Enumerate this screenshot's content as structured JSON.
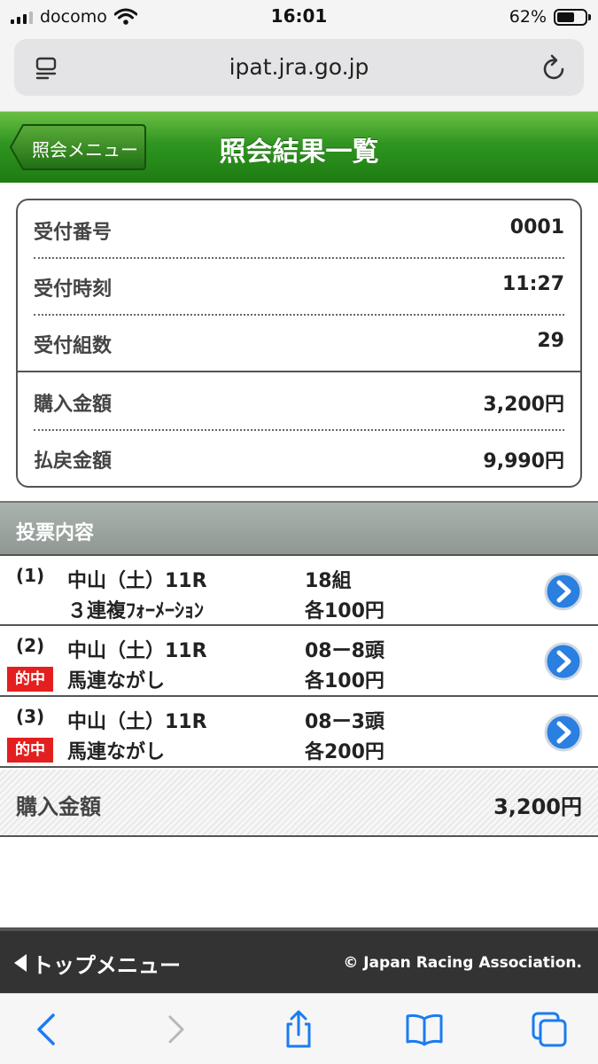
{
  "status_bar": {
    "carrier": "docomo",
    "time": "16:01",
    "battery": "62%",
    "battery_level": 0.62
  },
  "browser": {
    "url": "ipat.jra.go.jp"
  },
  "header": {
    "back_label": "照会メニュー",
    "title": "照会結果一覧"
  },
  "summary": {
    "rows": [
      {
        "label": "受付番号",
        "value": "0001"
      },
      {
        "label": "受付時刻",
        "value": "11:27"
      },
      {
        "label": "受付組数",
        "value": "29"
      },
      {
        "label": "購入金額",
        "value": "3,200円"
      },
      {
        "label": "払戻金額",
        "value": "9,990円"
      }
    ]
  },
  "bets": {
    "section_title": "投票内容",
    "items": [
      {
        "number": "(1)",
        "race": "中山（土）11R",
        "bet_type": "３連複ﾌｫｰﾒｰｼｮﾝ",
        "count": "18組",
        "amount": "各100円",
        "badge": ""
      },
      {
        "number": "(2)",
        "race": "中山（土）11R",
        "bet_type": "馬連ながし",
        "count": "08ー8頭",
        "amount": "各100円",
        "badge": "的中"
      },
      {
        "number": "(3)",
        "race": "中山（土）11R",
        "bet_type": "馬連ながし",
        "count": "08ー3頭",
        "amount": "各200円",
        "badge": "的中"
      }
    ]
  },
  "total": {
    "label": "購入金額",
    "value": "3,200円"
  },
  "footer": {
    "top_menu": "トップメニュー",
    "copyright": "© Japan Racing Association."
  },
  "colors": {
    "header_green": "#2f9520",
    "hit_badge": "#e31f1f",
    "arrow_blue": "#2a7fe0",
    "footer_dark": "#333333",
    "ios_blue": "#1a7cf0"
  }
}
